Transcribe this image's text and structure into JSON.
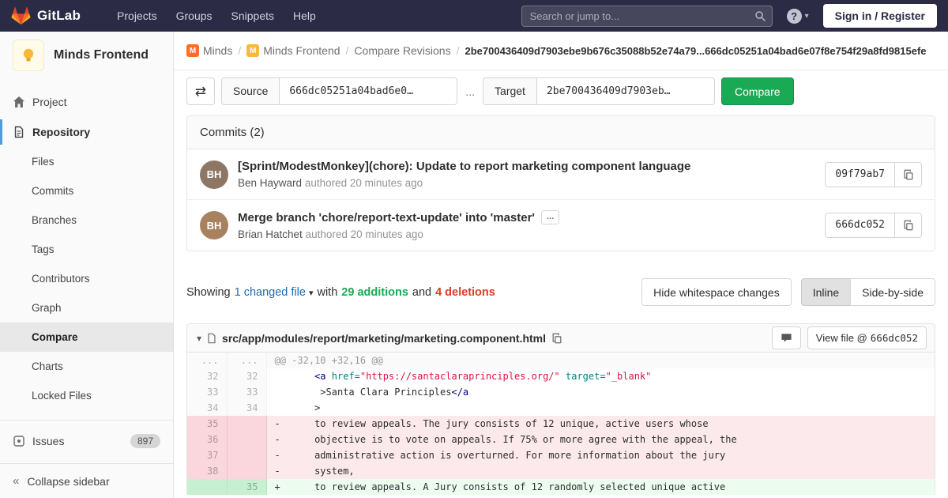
{
  "colors": {
    "navbar_bg": "#2b2b46",
    "accent_green": "#1aaa55",
    "danger_red": "#db3b21",
    "link_blue": "#1b69b6",
    "active_indicator_blue": "#4b9fd5"
  },
  "icons": {
    "swap_glyph": "⇄",
    "caret_glyph": "▾",
    "collapse_glyph": "«",
    "ellipsis_glyph": "...",
    "help_glyph": "?"
  },
  "navbar": {
    "brand": "GitLab",
    "items": [
      "Projects",
      "Groups",
      "Snippets",
      "Help"
    ],
    "search_placeholder": "Search or jump to...",
    "signin_label": "Sign in / Register"
  },
  "sidebar": {
    "project_name": "Minds Frontend",
    "project_item": "Project",
    "repository_item": "Repository",
    "repo_subitems": [
      {
        "label": "Files",
        "active": false
      },
      {
        "label": "Commits",
        "active": false
      },
      {
        "label": "Branches",
        "active": false
      },
      {
        "label": "Tags",
        "active": false
      },
      {
        "label": "Contributors",
        "active": false
      },
      {
        "label": "Graph",
        "active": false
      },
      {
        "label": "Compare",
        "active": true
      },
      {
        "label": "Charts",
        "active": false
      },
      {
        "label": "Locked Files",
        "active": false
      }
    ],
    "issues_label": "Issues",
    "issues_count": "897",
    "collapse_label": "Collapse sidebar"
  },
  "breadcrumb": {
    "separator": "/",
    "items": [
      {
        "label": "Minds",
        "initial": "M",
        "avatar_color": "#fc6d26"
      },
      {
        "label": "Minds Frontend",
        "initial": "M",
        "avatar_color": "#f6b93b"
      },
      {
        "label": "Compare Revisions"
      }
    ],
    "current": "2be700436409d7903ebe9b676c35088b52e74a79...666dc05251a04bad6e07f8e754f29a8fd9815efe"
  },
  "compare_form": {
    "source_label": "Source",
    "source_value": "666dc05251a04bad6e0…",
    "separator": "...",
    "target_label": "Target",
    "target_value": "2be700436409d7903eb…",
    "compare_button": "Compare"
  },
  "commits": {
    "header": "Commits (2)",
    "items": [
      {
        "title": "[Sprint/ModestMonkey](chore): Update to report marketing component language",
        "author": "Ben Hayward",
        "meta": "authored 20 minutes ago",
        "hash": "09f79ab7",
        "initials": "BH",
        "avatar_color": "#8d7663",
        "expandable": false
      },
      {
        "title": "Merge branch 'chore/report-text-update' into 'master'",
        "author": "Brian Hatchet",
        "meta": "authored 20 minutes ago",
        "hash": "666dc052",
        "initials": "BH",
        "avatar_color": "#a8815f",
        "expandable": true
      }
    ]
  },
  "summary": {
    "showing": "Showing",
    "changed": "1 changed file",
    "with_text": "with",
    "additions": "29 additions",
    "and_text": "and",
    "deletions": "4 deletions",
    "hide_whitespace": "Hide whitespace changes",
    "inline": "Inline",
    "side_by_side": "Side-by-side"
  },
  "diff": {
    "path": "src/app/modules/report/marketing/marketing.component.html",
    "view_file_label": "View file @",
    "view_file_sha": "666dc052",
    "lines": [
      {
        "type": "hunk",
        "old": "...",
        "new": "...",
        "segments": [
          {
            "t": "@@ -32,10 +32,16 @@",
            "c": ""
          }
        ]
      },
      {
        "type": "context",
        "old": "32",
        "new": "32",
        "segments": [
          {
            "t": "       ",
            "c": ""
          },
          {
            "t": "<a",
            "c": "nt"
          },
          {
            "t": " ",
            "c": ""
          },
          {
            "t": "href=",
            "c": "na"
          },
          {
            "t": "\"https://santaclaraprinciples.org/\"",
            "c": "s"
          },
          {
            "t": " ",
            "c": ""
          },
          {
            "t": "target=",
            "c": "na"
          },
          {
            "t": "\"_blank\"",
            "c": "s"
          }
        ]
      },
      {
        "type": "context",
        "old": "33",
        "new": "33",
        "segments": [
          {
            "t": "        >Santa Clara Principles",
            "c": ""
          },
          {
            "t": "</a",
            "c": "nt"
          }
        ]
      },
      {
        "type": "context",
        "old": "34",
        "new": "34",
        "segments": [
          {
            "t": "       >",
            "c": ""
          }
        ]
      },
      {
        "type": "del",
        "old": "35",
        "new": "",
        "segments": [
          {
            "t": "-      to review appeals. The jury consists of 12 unique, active users whose",
            "c": ""
          }
        ]
      },
      {
        "type": "del",
        "old": "36",
        "new": "",
        "segments": [
          {
            "t": "-      objective is to vote on appeals. If 75% or more agree with the appeal, the",
            "c": ""
          }
        ]
      },
      {
        "type": "del",
        "old": "37",
        "new": "",
        "segments": [
          {
            "t": "-      administrative action is overturned. For more information about the jury",
            "c": ""
          }
        ]
      },
      {
        "type": "del",
        "old": "38",
        "new": "",
        "segments": [
          {
            "t": "-      system,",
            "c": ""
          }
        ]
      },
      {
        "type": "add",
        "old": "",
        "new": "35",
        "segments": [
          {
            "t": "+      to review appeals. A Jury consists of 12 randomly selected unique active",
            "c": ""
          }
        ]
      }
    ]
  }
}
